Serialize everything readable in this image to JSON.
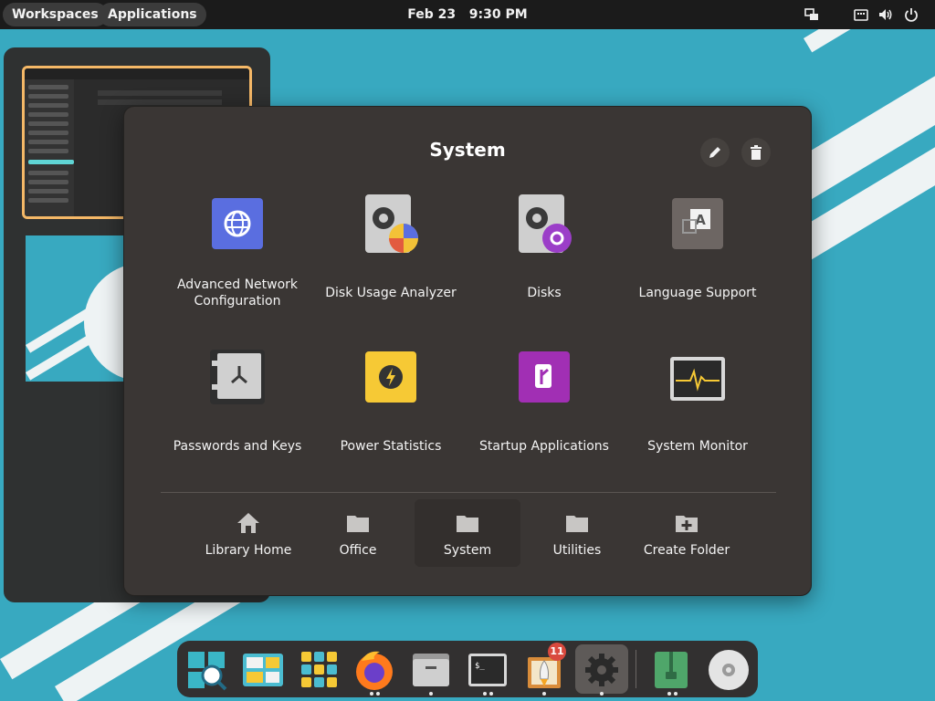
{
  "top_panel": {
    "workspaces_label": "Workspaces",
    "applications_label": "Applications",
    "date": "Feb 23",
    "time": "9:30 PM",
    "tray_icons": [
      "network-wired-icon",
      "keyboard-icon",
      "volume-icon",
      "power-icon"
    ]
  },
  "folder": {
    "title": "System",
    "header_buttons": [
      "edit-pencil-icon",
      "trash-icon"
    ],
    "apps": [
      {
        "label_line1": "Advanced Network",
        "label_line2": "Configuration",
        "icon": "network-globe-icon"
      },
      {
        "label_line1": "Disk Usage Analyzer",
        "label_line2": "",
        "icon": "disk-usage-pie-icon"
      },
      {
        "label_line1": "Disks",
        "label_line2": "",
        "icon": "disks-gear-icon"
      },
      {
        "label_line1": "Language Support",
        "label_line2": "",
        "icon": "language-keyboard-icon"
      },
      {
        "label_line1": "Passwords and Keys",
        "label_line2": "",
        "icon": "keyring-safe-icon"
      },
      {
        "label_line1": "Power Statistics",
        "label_line2": "",
        "icon": "power-bolt-icon"
      },
      {
        "label_line1": "Startup Applications",
        "label_line2": "",
        "icon": "startup-apps-icon"
      },
      {
        "label_line1": "System Monitor",
        "label_line2": "",
        "icon": "system-monitor-icon"
      }
    ],
    "bottom_buttons": [
      {
        "label": "Library Home",
        "icon": "home-icon"
      },
      {
        "label": "Office",
        "icon": "folder-icon"
      },
      {
        "label": "System",
        "icon": "folder-icon",
        "active": true
      },
      {
        "label": "Utilities",
        "icon": "folder-icon"
      },
      {
        "label": "Create Folder",
        "icon": "folder-add-icon"
      }
    ]
  },
  "dock": {
    "items": [
      "app-search-icon",
      "multitasking-icon",
      "app-grid-icon",
      "firefox-icon",
      "files-icon",
      "terminal-icon",
      "app-installer-icon",
      "settings-gear-icon",
      "archive-manager-icon",
      "disc-icon"
    ],
    "badge_count": "11"
  },
  "colors": {
    "accent": "#f5b867",
    "wallpaper": "#38a9c0",
    "panel": "#1b1b1b",
    "folder_bg": "#3a3634"
  }
}
